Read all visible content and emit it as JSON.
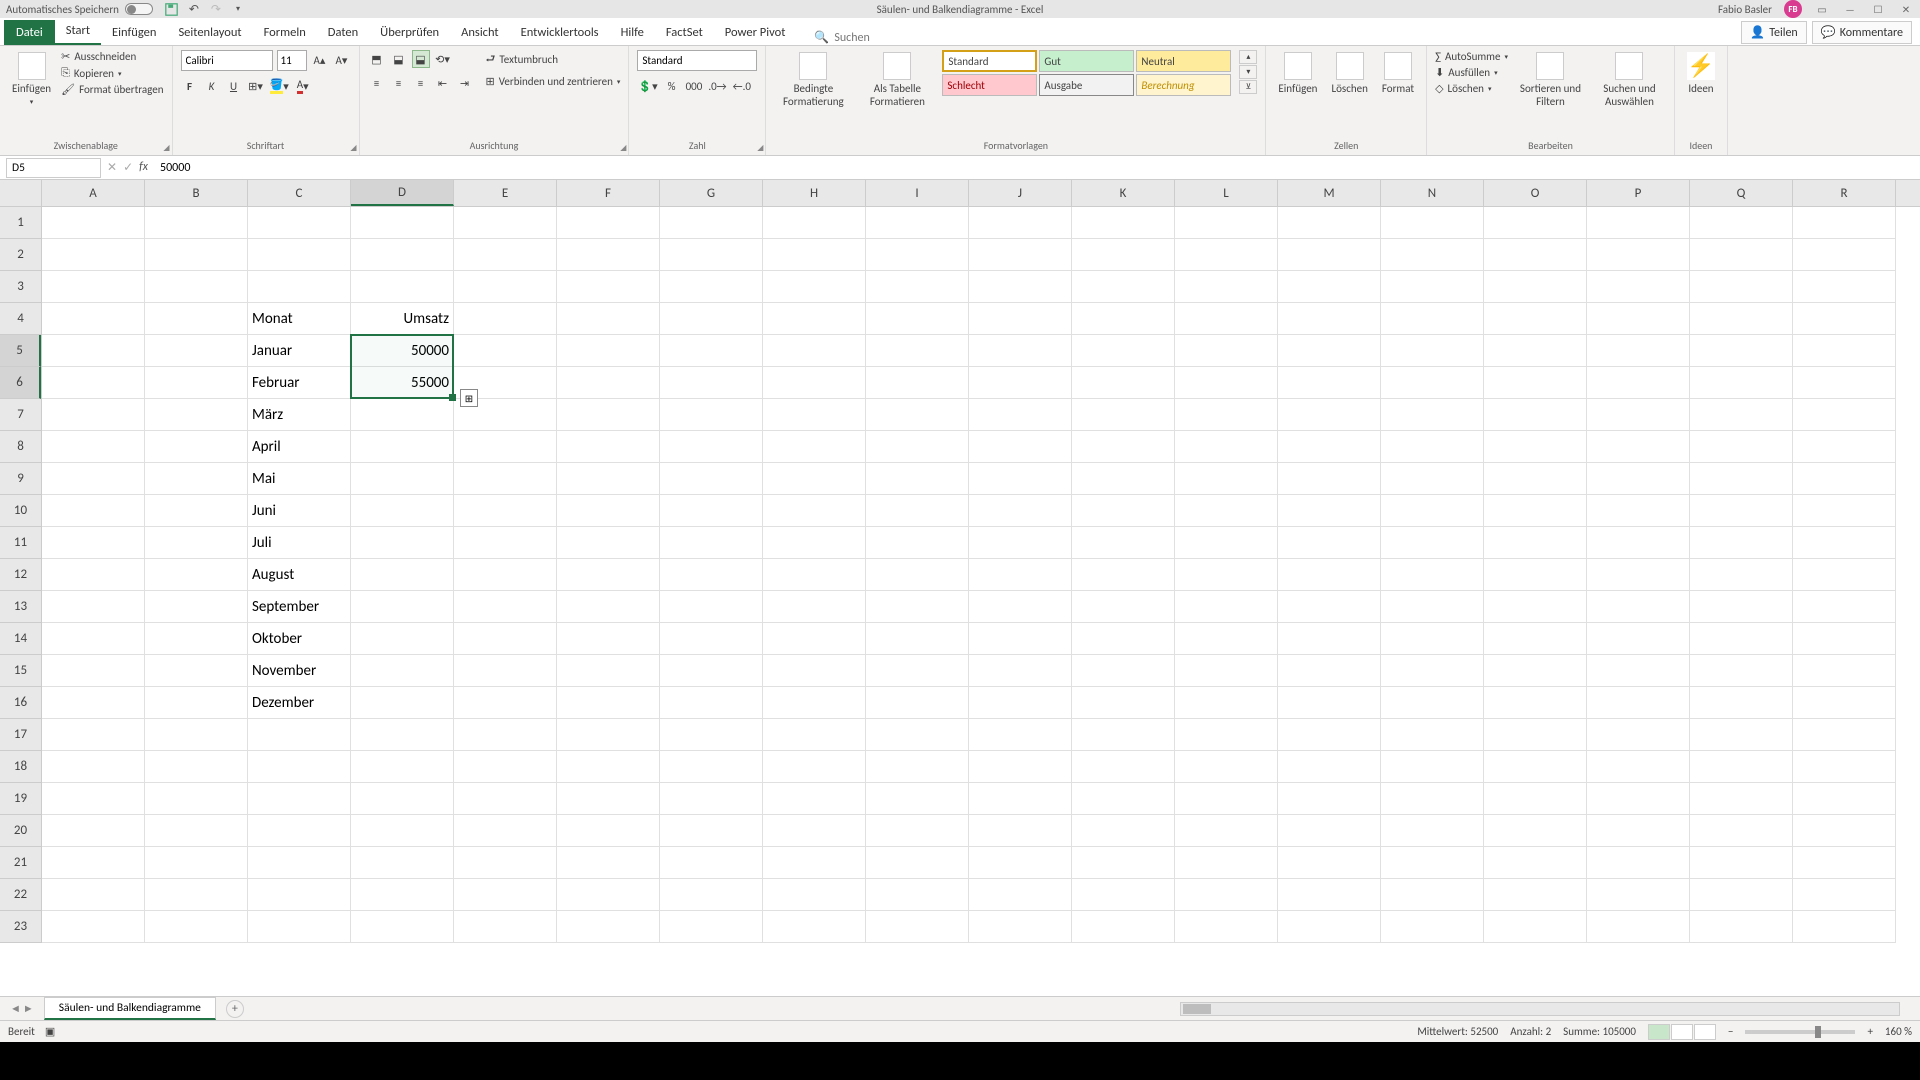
{
  "titlebar": {
    "autosave_label": "Automatisches Speichern",
    "doc_title": "Säulen- und Balkendiagramme - Excel",
    "user_name": "Fabio Basler",
    "user_initials": "FB"
  },
  "tabs": {
    "file": "Datei",
    "list": [
      "Start",
      "Einfügen",
      "Seitenlayout",
      "Formeln",
      "Daten",
      "Überprüfen",
      "Ansicht",
      "Entwicklertools",
      "Hilfe",
      "FactSet",
      "Power Pivot"
    ],
    "active": "Start",
    "search_placeholder": "Suchen",
    "share": "Teilen",
    "comments": "Kommentare"
  },
  "ribbon": {
    "clipboard": {
      "paste": "Einfügen",
      "cut": "Ausschneiden",
      "copy": "Kopieren",
      "format_painter": "Format übertragen",
      "label": "Zwischenablage"
    },
    "font": {
      "name": "Calibri",
      "size": "11",
      "label": "Schriftart"
    },
    "align": {
      "wrap": "Textumbruch",
      "merge": "Verbinden und zentrieren",
      "label": "Ausrichtung"
    },
    "number": {
      "format": "Standard",
      "label": "Zahl"
    },
    "styles": {
      "cond": "Bedingte Formatierung",
      "table": "Als Tabelle Formatieren",
      "s1": "Standard",
      "s2": "Gut",
      "s3": "Neutral",
      "s4": "Schlecht",
      "s5": "Ausgabe",
      "s6": "Berechnung",
      "label": "Formatvorlagen"
    },
    "cells": {
      "insert": "Einfügen",
      "delete": "Löschen",
      "format": "Format",
      "label": "Zellen"
    },
    "editing": {
      "sum": "AutoSumme",
      "fill": "Ausfüllen",
      "clear": "Löschen",
      "sort": "Sortieren und Filtern",
      "find": "Suchen und Auswählen",
      "label": "Bearbeiten"
    },
    "ideas": {
      "btn": "Ideen",
      "label": "Ideen"
    }
  },
  "formula_bar": {
    "cell_ref": "D5",
    "value": "50000"
  },
  "columns": [
    "A",
    "B",
    "C",
    "D",
    "E",
    "F",
    "G",
    "H",
    "I",
    "J",
    "K",
    "L",
    "M",
    "N",
    "O",
    "P",
    "Q",
    "R"
  ],
  "rows_count": 23,
  "selected_col_index": 3,
  "selected_rows": [
    4,
    5
  ],
  "cells_data": {
    "C4": "Monat",
    "D4": "Umsatz",
    "C5": "Januar",
    "D5": "50000",
    "C6": "Februar",
    "D6": "55000",
    "C7": "März",
    "C8": "April",
    "C9": "Mai",
    "C10": "Juni",
    "C11": "Juli",
    "C12": "August",
    "C13": "September",
    "C14": "Oktober",
    "C15": "November",
    "C16": "Dezember"
  },
  "sheet_tab": "Säulen- und Balkendiagramme",
  "status": {
    "ready": "Bereit",
    "avg_label": "Mittelwert:",
    "avg_val": "52500",
    "count_label": "Anzahl:",
    "count_val": "2",
    "sum_label": "Summe:",
    "sum_val": "105000",
    "zoom": "160 %"
  }
}
